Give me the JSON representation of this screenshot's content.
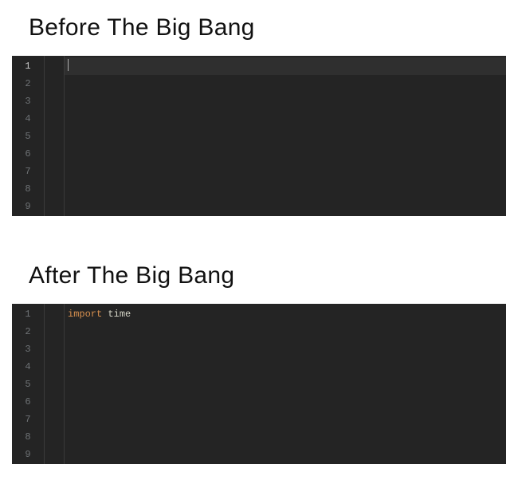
{
  "panels": {
    "before": {
      "heading": "Before The Big Bang",
      "line_numbers": [
        "1",
        "2",
        "3",
        "4",
        "5",
        "6",
        "7",
        "8",
        "9"
      ],
      "code_lines": [
        ""
      ]
    },
    "after": {
      "heading": "After The Big Bang",
      "line_numbers": [
        "1",
        "2",
        "3",
        "4",
        "5",
        "6",
        "7",
        "8",
        "9"
      ],
      "code_tokens_line1": {
        "keyword": "import",
        "module": "time"
      }
    }
  },
  "colors": {
    "editor_bg": "#242424",
    "gutter_text": "#6e7275",
    "gutter_active": "#c7c7c7",
    "keyword": "#d68f4e",
    "identifier": "#d6d6c8"
  }
}
